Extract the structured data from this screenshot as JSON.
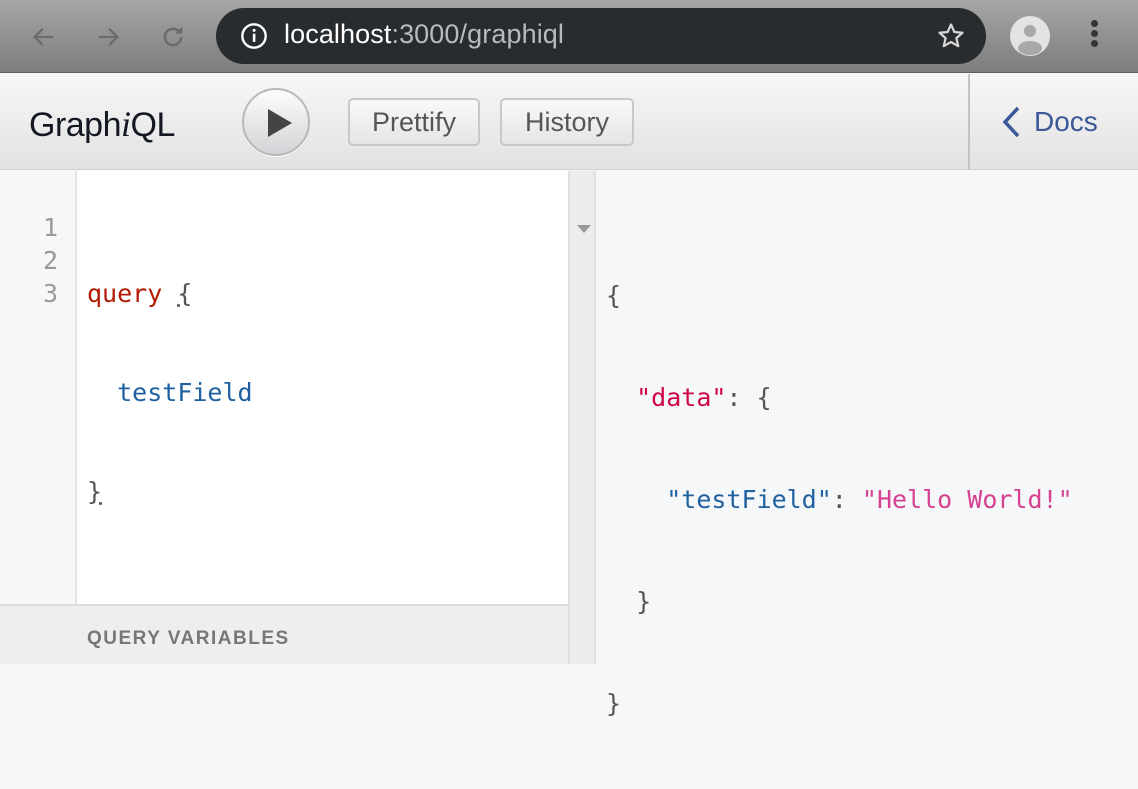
{
  "browser": {
    "url_host": "localhost",
    "url_rest": ":3000/graphiql",
    "icons": {
      "back": "arrow-left-icon",
      "forward": "arrow-right-icon",
      "reload": "reload-icon",
      "info": "info-icon",
      "bookmark": "star-icon",
      "profile": "avatar-icon",
      "menu": "kebab-menu-icon"
    }
  },
  "topbar": {
    "logo_pre": "Graph",
    "logo_i": "i",
    "logo_post": "QL",
    "execute_label": "Execute Query",
    "prettify_label": "Prettify",
    "history_label": "History",
    "docs_label": "Docs"
  },
  "editor": {
    "line_numbers": [
      "1",
      "2",
      "3"
    ],
    "lines": [
      {
        "keyword": "query",
        "brace": "{"
      },
      {
        "indent": "  ",
        "field": "testField"
      },
      {
        "brace": "}"
      }
    ]
  },
  "variables": {
    "title": "QUERY VARIABLES"
  },
  "result": {
    "open": "{",
    "data_key": "\"data\"",
    "colon": ": ",
    "data_open": "{",
    "field_key": "\"testField\"",
    "field_value": "\"Hello World!\"",
    "data_close": "}",
    "close": "}"
  },
  "colors": {
    "keyword": "#b11a04",
    "field": "#1f61a0",
    "result_top_key": "#cf0548",
    "result_string": "#d64292",
    "docs_link": "#3b5998"
  }
}
